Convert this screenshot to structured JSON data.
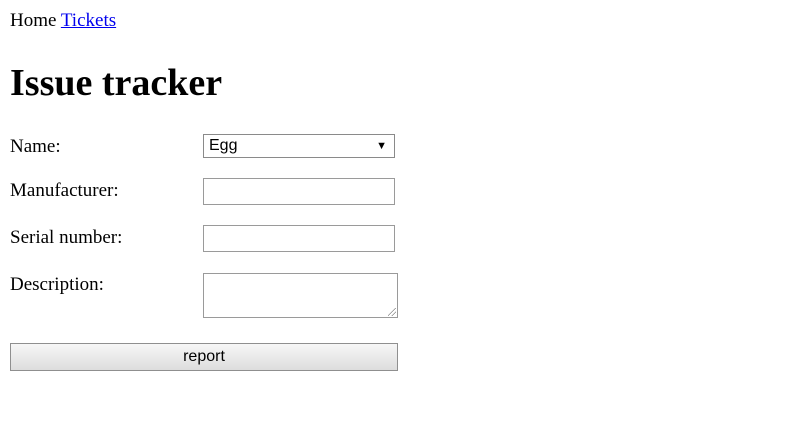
{
  "nav": {
    "home": "Home",
    "tickets": "Tickets"
  },
  "header": {
    "title": "Issue tracker"
  },
  "form": {
    "name": {
      "label": "Name:",
      "selected": "Egg",
      "arrow": "▼"
    },
    "manufacturer": {
      "label": "Manufacturer:",
      "value": ""
    },
    "serial_number": {
      "label": "Serial number:",
      "value": ""
    },
    "description": {
      "label": "Description:",
      "value": ""
    },
    "submit_label": "report"
  },
  "icons": {
    "dropdown": "chevron-down-icon",
    "resize": "resize-grip-icon"
  },
  "colors": {
    "link": "#0000ee",
    "text": "#000000",
    "background": "#ffffff"
  }
}
